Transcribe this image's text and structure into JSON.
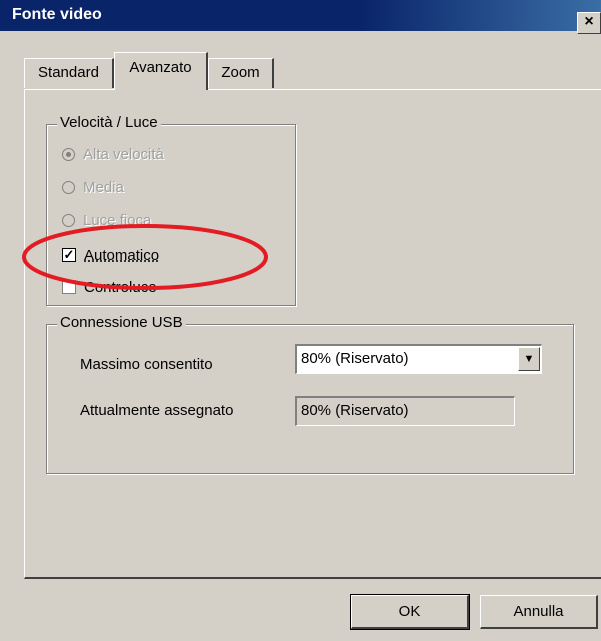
{
  "window": {
    "title": "Fonte video",
    "close_glyph": "×"
  },
  "tabs": [
    {
      "label": "Standard",
      "active": false
    },
    {
      "label": "Avanzato",
      "active": true
    },
    {
      "label": "Zoom",
      "active": false
    }
  ],
  "speed_group": {
    "label": "Velocità / Luce",
    "options": [
      {
        "label": "Alta velocità",
        "selected": true,
        "enabled": false
      },
      {
        "label": "Media",
        "selected": false,
        "enabled": false
      },
      {
        "label": "Luce fioca",
        "selected": false,
        "enabled": false
      }
    ],
    "automatico": {
      "label": "Automatico",
      "checked": true,
      "check_glyph": "✓"
    },
    "controluce": {
      "label": "Controluce",
      "checked": false
    }
  },
  "usb_group": {
    "label": "Connessione USB",
    "max_label": "Massimo consentito",
    "max_value": "80% (Riservato)",
    "assigned_label": "Attualmente assegnato",
    "assigned_value": "80% (Riservato)",
    "dropdown_glyph": "▼"
  },
  "buttons": {
    "ok": "OK",
    "cancel": "Annulla"
  },
  "colors": {
    "title_bar": "#0a246a",
    "dialog_bg": "#d4d0c8",
    "annotation": "#e31b23"
  }
}
